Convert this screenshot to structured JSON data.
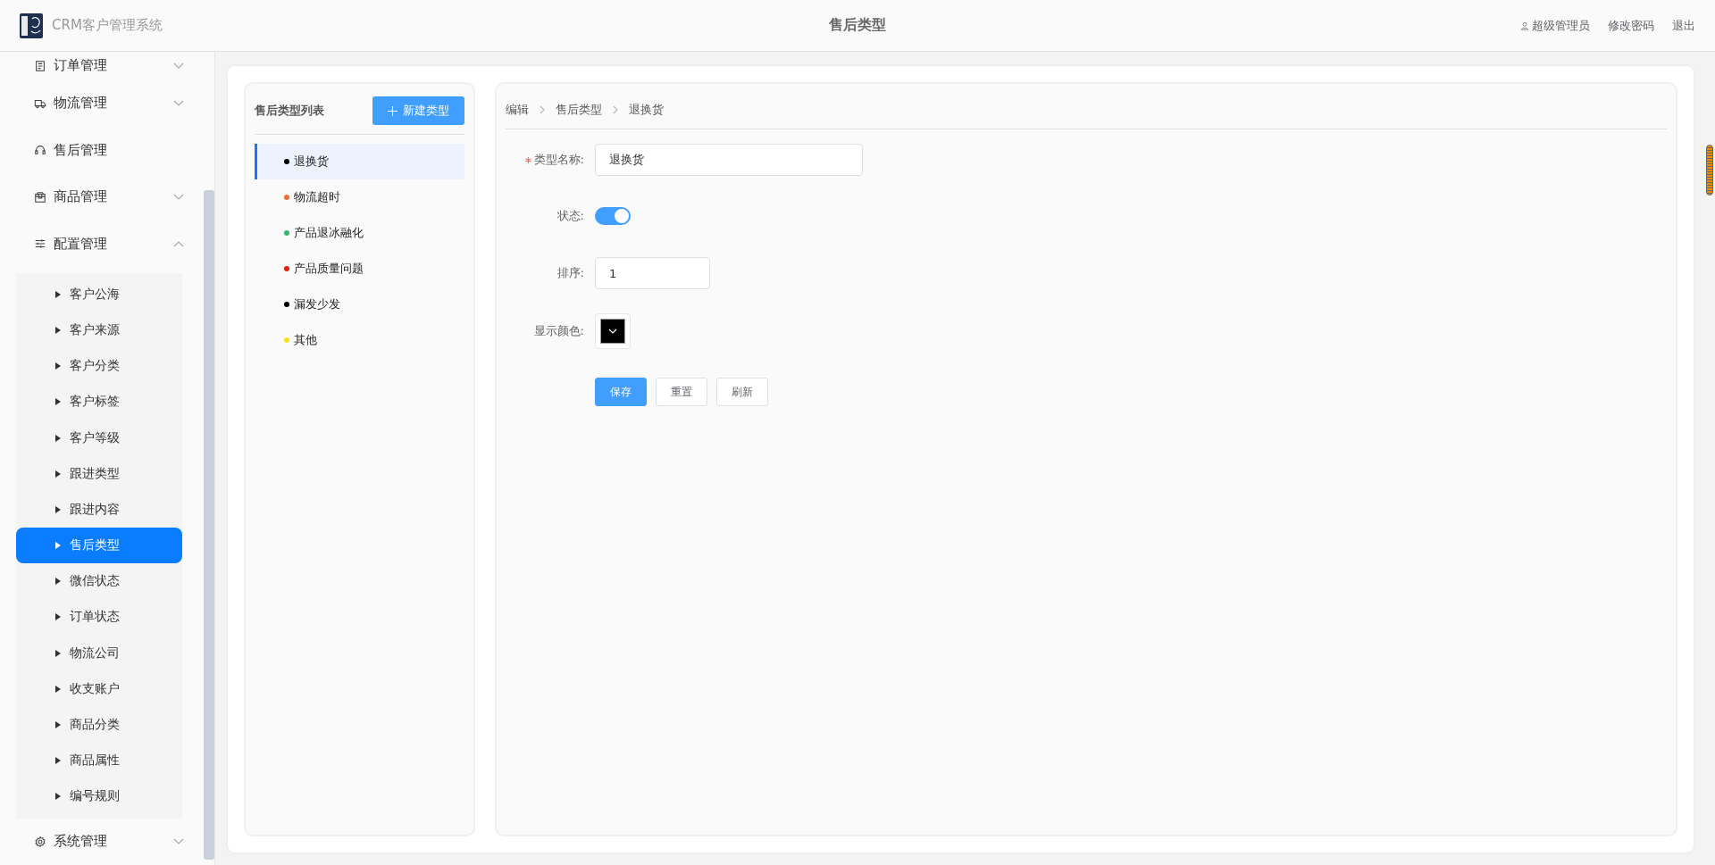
{
  "header": {
    "app_name": "CRM客户管理系统",
    "title": "售后类型",
    "user": "超级管理员",
    "links": [
      "修改密码",
      "退出"
    ]
  },
  "sidebar": {
    "items": [
      {
        "label": "订单管理",
        "expanded": false,
        "has_children": true
      },
      {
        "label": "物流管理",
        "expanded": false,
        "has_children": true
      },
      {
        "label": "售后管理",
        "expanded": false,
        "has_children": false
      },
      {
        "label": "商品管理",
        "expanded": false,
        "has_children": true
      },
      {
        "label": "配置管理",
        "expanded": true,
        "has_children": true,
        "children": [
          {
            "label": "客户公海",
            "selected": false
          },
          {
            "label": "客户来源",
            "selected": false
          },
          {
            "label": "客户分类",
            "selected": false
          },
          {
            "label": "客户标签",
            "selected": false
          },
          {
            "label": "客户等级",
            "selected": false
          },
          {
            "label": "跟进类型",
            "selected": false
          },
          {
            "label": "跟进内容",
            "selected": false
          },
          {
            "label": "售后类型",
            "selected": true
          },
          {
            "label": "微信状态",
            "selected": false
          },
          {
            "label": "订单状态",
            "selected": false
          },
          {
            "label": "物流公司",
            "selected": false
          },
          {
            "label": "收支账户",
            "selected": false
          },
          {
            "label": "商品分类",
            "selected": false
          },
          {
            "label": "商品属性",
            "selected": false
          },
          {
            "label": "编号规则",
            "selected": false
          }
        ]
      },
      {
        "label": "系统管理",
        "expanded": false,
        "has_children": true
      }
    ]
  },
  "type_list": {
    "title": "售后类型列表",
    "new_button": "新建类型",
    "items": [
      {
        "label": "退换货",
        "color": "#000000",
        "selected": true
      },
      {
        "label": "物流超时",
        "color": "#e8703a",
        "selected": false
      },
      {
        "label": "产品退冰融化",
        "color": "#3cb371",
        "selected": false
      },
      {
        "label": "产品质量问题",
        "color": "#dd2211",
        "selected": false
      },
      {
        "label": "漏发少发",
        "color": "#000000",
        "selected": false
      },
      {
        "label": "其他",
        "color": "#f5e322",
        "selected": false
      }
    ]
  },
  "breadcrumb": [
    "编辑",
    "售后类型",
    "退换货"
  ],
  "form": {
    "name_label": "类型名称:",
    "name_required": true,
    "name_value": "退换货",
    "status_label": "状态:",
    "status_on": true,
    "sort_label": "排序:",
    "sort_value": "1",
    "color_label": "显示颜色:",
    "color": "#000000",
    "buttons": [
      {
        "label": "保存",
        "kind": "primary"
      },
      {
        "label": "重置",
        "kind": "default"
      },
      {
        "label": "刷新",
        "kind": "default"
      }
    ]
  }
}
